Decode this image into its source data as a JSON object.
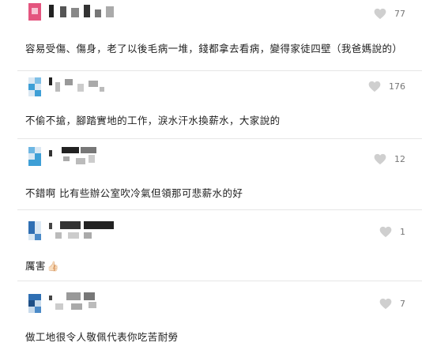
{
  "comments": [
    {
      "text": "容易受傷、傷身，老了以後毛病一堆，錢都拿去看病，變得家徒四壁（我爸媽說的）",
      "likes": "77",
      "avatar_color": "#d9487a"
    },
    {
      "text": "不偷不搶，腳踏實地的工作，淚水汗水換薪水，大家說的",
      "likes": "176",
      "avatar_color": "#3e9fd6"
    },
    {
      "text": "不錯啊  比有些辦公室吹冷氣但領那可悲薪水的好",
      "likes": "12",
      "avatar_color": "#3e9fd6"
    },
    {
      "text": "厲害",
      "likes": "1",
      "avatar_color": "#2f6fb3",
      "emoji": "👍🏻"
    },
    {
      "text": "做工地很令人敬佩代表你吃苦耐勞",
      "likes": "7",
      "avatar_color": "#2f6fb3"
    }
  ],
  "colors": {
    "heart_icon": "#cfcfcf",
    "divider": "#e6e6e6",
    "text": "#222222"
  },
  "icons": {
    "like": "heart-icon"
  }
}
